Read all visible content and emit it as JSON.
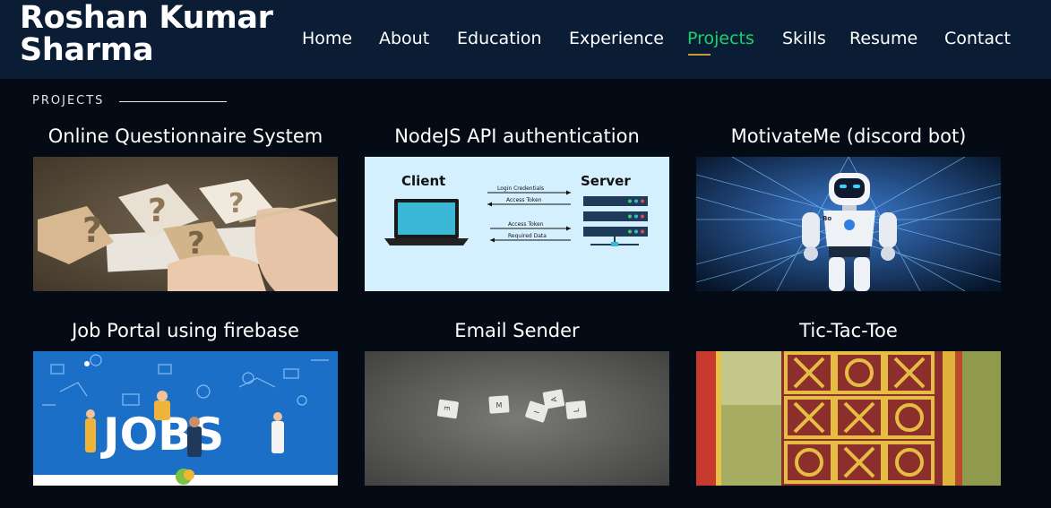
{
  "header": {
    "name": "Roshan Kumar Sharma",
    "nav": [
      {
        "label": "Home"
      },
      {
        "label": "About"
      },
      {
        "label": "Education"
      },
      {
        "label": "Experience"
      },
      {
        "label": "Projects",
        "active": true
      },
      {
        "label": "Skills"
      },
      {
        "label": "Resume"
      },
      {
        "label": "Contact"
      }
    ]
  },
  "section": {
    "label": "PROJECTS"
  },
  "projects": [
    {
      "title": "Online Questionnaire System",
      "image_icon": "question-marks-photo"
    },
    {
      "title": "NodeJS API authentication",
      "image_icon": "client-server-diagram",
      "diagram": {
        "client": "Client",
        "server": "Server",
        "arrows": [
          "Login Credentials",
          "Access Token",
          "Access Token",
          "Required Data"
        ]
      }
    },
    {
      "title": "MotivateMe (discord bot)",
      "image_icon": "robot-photo",
      "robot_badge": "Bo"
    },
    {
      "title": "Job Portal using firebase",
      "image_icon": "jobs-illustration",
      "banner_text": "JOBS"
    },
    {
      "title": "Email Sender",
      "image_icon": "email-tiles-photo",
      "tiles": [
        "E",
        "M",
        "A",
        "I",
        "L"
      ]
    },
    {
      "title": "Tic-Tac-Toe",
      "image_icon": "tic-tac-toe-photo"
    }
  ],
  "colors": {
    "background": "#040b14",
    "header": "#0b1d34",
    "accent": "#18d26e",
    "underline": "#c79a38"
  }
}
